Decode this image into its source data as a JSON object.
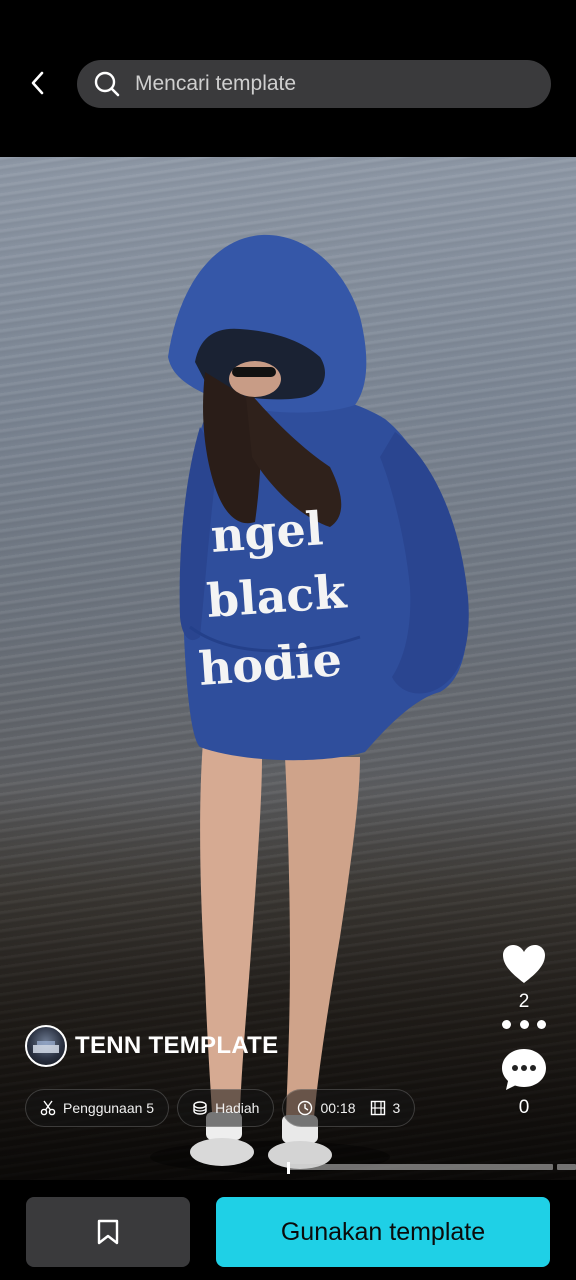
{
  "header": {
    "search_placeholder": "Mencari template"
  },
  "media": {
    "hoodie_text": [
      "ngel",
      "black",
      "hodie"
    ]
  },
  "actions": {
    "like_count": "2",
    "comment_count": "0"
  },
  "author": {
    "name": "TENN TEMPLATE"
  },
  "chips": {
    "usage_label": "Penggunaan 5",
    "gift_label": "Hadiah",
    "duration": "00:18",
    "clips": "3"
  },
  "playback": {
    "progress": 0.0
  },
  "bottom": {
    "use_label": "Gunakan template"
  },
  "colors": {
    "accent": "#1fd0e6",
    "hoodie": "#2f4e9c"
  }
}
